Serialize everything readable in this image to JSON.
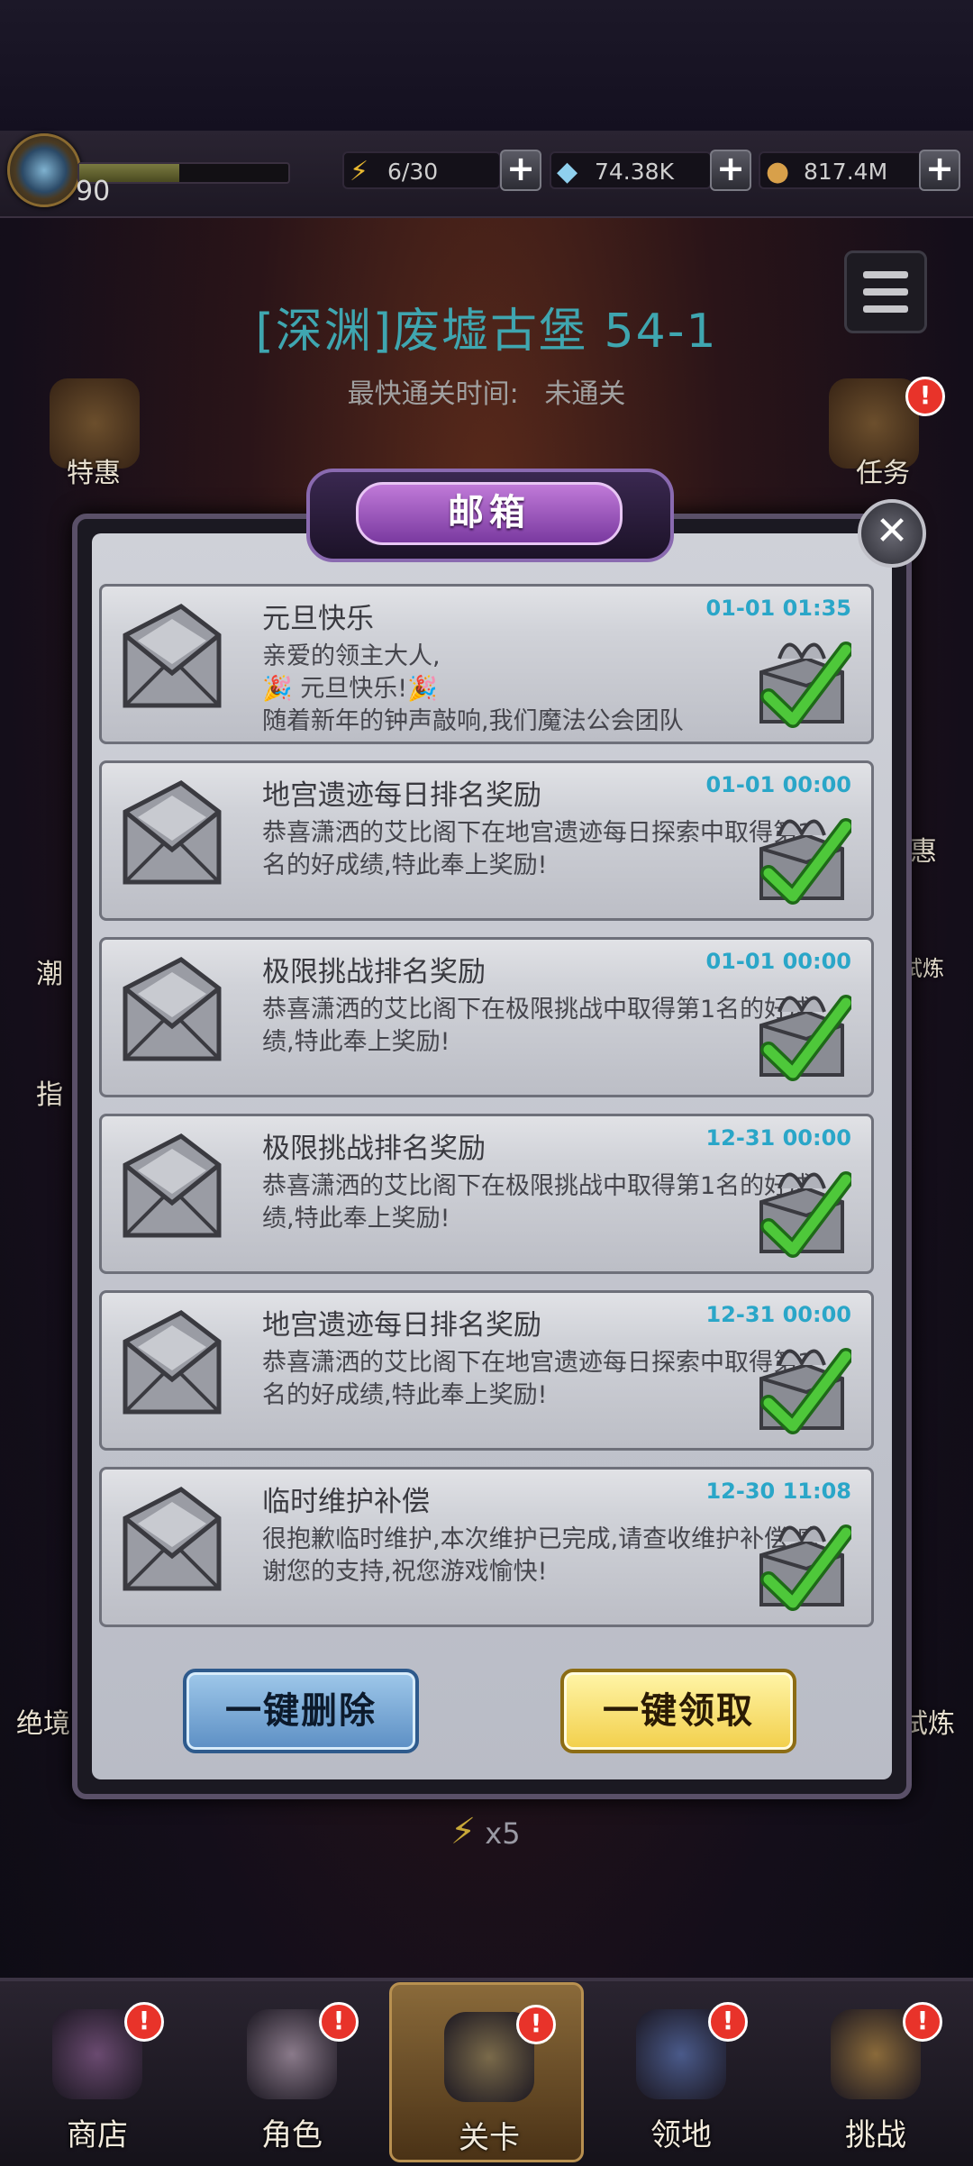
{
  "top": {
    "level": "90",
    "level_progress": 0.48,
    "energy": "6/30",
    "gems": "74.38K",
    "gold": "817.4M"
  },
  "stage": {
    "title": "[深渊]废墟古堡 54-1",
    "fastest_label": "最快通关时间:",
    "fastest_value": "未通关"
  },
  "side": {
    "left_1": "特惠",
    "left_2": "潮",
    "left_3": "指",
    "left_4": "绝境",
    "right_1": "任务",
    "right_2": "惠",
    "right_3": "试炼",
    "right_4": "试炼"
  },
  "mailbox": {
    "title": "邮箱",
    "mails": [
      {
        "title": "元旦快乐",
        "date": "01-01 01:35",
        "body": "亲爱的领主大人,\n🎉 元旦快乐!🎉\n随着新年的钟声敲响,我们魔法公会团队"
      },
      {
        "title": "地宫遗迹每日排名奖励",
        "date": "01-01 00:00",
        "body": "恭喜潇洒的艾比阁下在地宫遗迹每日探索中取得第1名的好成绩,特此奉上奖励!"
      },
      {
        "title": "极限挑战排名奖励",
        "date": "01-01 00:00",
        "body": "恭喜潇洒的艾比阁下在极限挑战中取得第1名的好成绩,特此奉上奖励!"
      },
      {
        "title": "极限挑战排名奖励",
        "date": "12-31 00:00",
        "body": "恭喜潇洒的艾比阁下在极限挑战中取得第1名的好成绩,特此奉上奖励!"
      },
      {
        "title": "地宫遗迹每日排名奖励",
        "date": "12-31 00:00",
        "body": "恭喜潇洒的艾比阁下在地宫遗迹每日探索中取得第1名的好成绩,特此奉上奖励!"
      },
      {
        "title": "临时维护补偿",
        "date": "12-30 11:08",
        "body": "很抱歉临时维护,本次维护已完成,请查收维护补偿,感谢您的支持,祝您游戏愉快!"
      }
    ],
    "delete_all_label": "一键删除",
    "claim_all_label": "一键领取"
  },
  "energy_multiplier": "x5",
  "nav": [
    {
      "label": "商店",
      "badge": "!"
    },
    {
      "label": "角色",
      "badge": "!"
    },
    {
      "label": "关卡",
      "badge": "!"
    },
    {
      "label": "领地",
      "badge": "!"
    },
    {
      "label": "挑战",
      "badge": "!"
    }
  ],
  "colors": {
    "accent_cyan": "#2aa6c8",
    "badge_red": "#e8332a",
    "check_green": "#4ec83a"
  }
}
